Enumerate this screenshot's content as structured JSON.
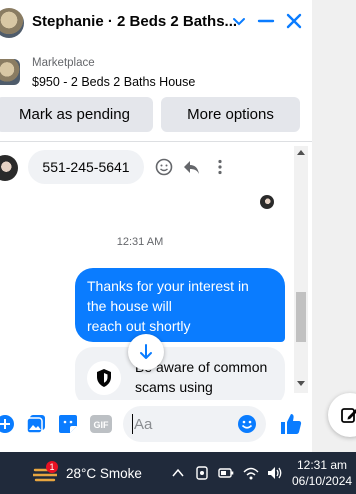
{
  "header": {
    "title": "Stephanie · 2 Beds 2 Baths...",
    "icons": [
      "chevron-down-icon",
      "minimize-icon",
      "close-icon"
    ],
    "accent": "#0a7cff"
  },
  "marketplace": {
    "label": "Marketplace",
    "listing": "$950 - 2 Beds 2 Baths House"
  },
  "actions": {
    "mark_pending": "Mark as pending",
    "more_options": "More options"
  },
  "messages": {
    "phone": "551-245-5641",
    "timestamp": "12:31 AM",
    "outgoing_line1": "Thanks for your interest in",
    "outgoing_line2": "the house will",
    "outgoing_line3": "reach out shortly",
    "scam_line1": "Be aware of common",
    "scam_line2": "scams using"
  },
  "composer": {
    "placeholder": "Aa"
  },
  "taskbar": {
    "weather": "28°C  Smoke",
    "notification_count": "1",
    "time": "12:31 am",
    "date": "06/10/2024"
  }
}
